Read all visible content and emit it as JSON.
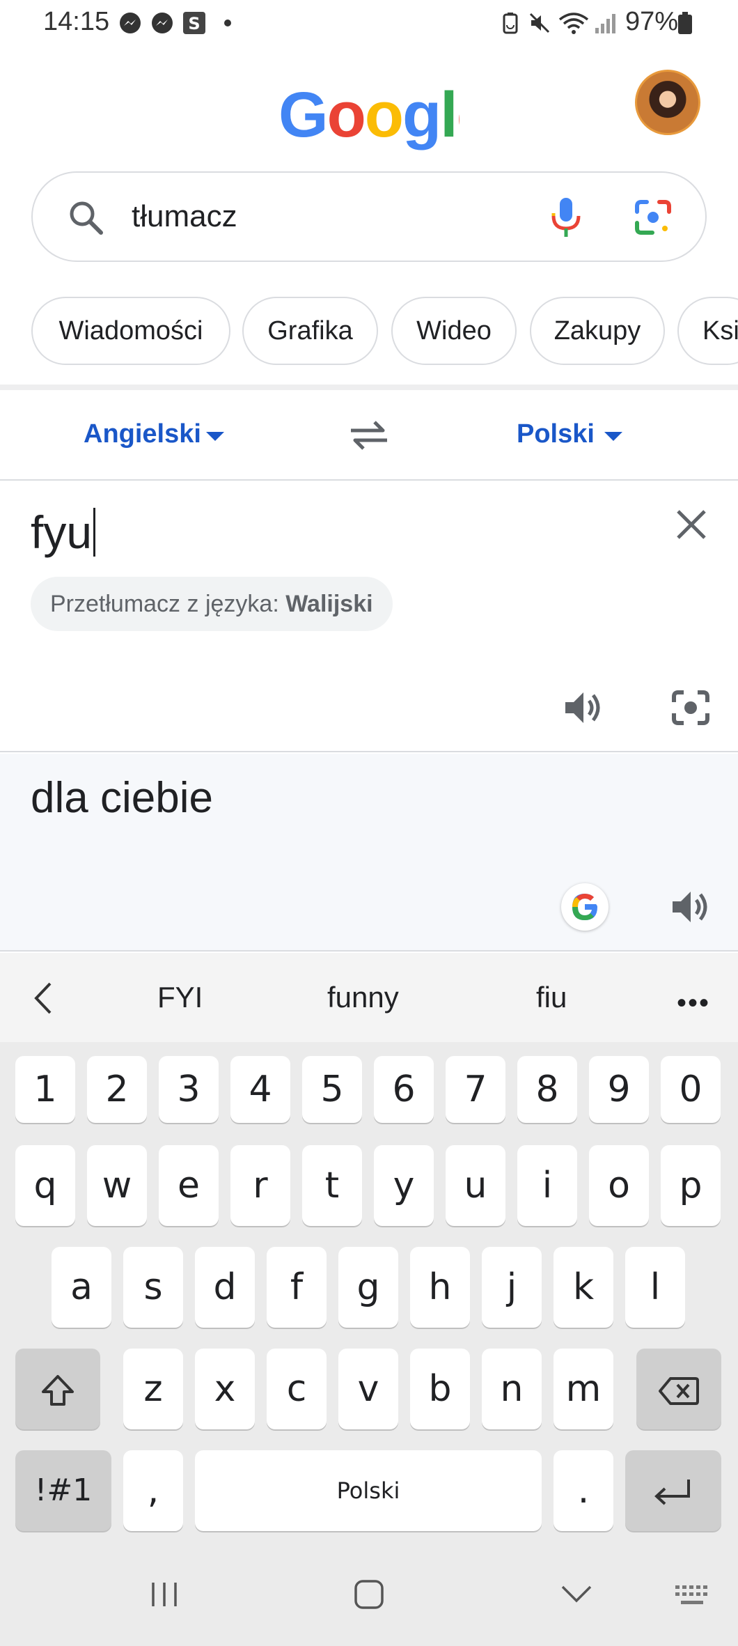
{
  "status_bar": {
    "time": "14:15",
    "battery": "97%",
    "icons": [
      "messenger-icon",
      "messenger-icon",
      "s-app-icon",
      "notification-dot",
      "battery-saver-icon",
      "mute-icon",
      "wifi-icon",
      "signal-icon",
      "battery-icon"
    ]
  },
  "header": {
    "logo_text": "Google",
    "logo_colors": [
      "#4285F4",
      "#EA4335",
      "#FBBC05",
      "#4285F4",
      "#34A853",
      "#EA4335"
    ]
  },
  "search": {
    "query": "tłumacz"
  },
  "chips": [
    {
      "label": "Wiadomości"
    },
    {
      "label": "Grafika"
    },
    {
      "label": "Wideo"
    },
    {
      "label": "Zakupy"
    },
    {
      "label": "Ksi"
    }
  ],
  "translator": {
    "source_lang": "Angielski",
    "target_lang": "Polski",
    "input_text": "fyu",
    "detect_prefix": "Przetłumacz z języka:",
    "detect_lang": "Walijski",
    "output_text": "dla ciebie"
  },
  "keyboard": {
    "suggestions": [
      "FYI",
      "funny",
      "fiu"
    ],
    "more": "•••",
    "row_numbers": [
      "1",
      "2",
      "3",
      "4",
      "5",
      "6",
      "7",
      "8",
      "9",
      "0"
    ],
    "row1": [
      "q",
      "w",
      "e",
      "r",
      "t",
      "y",
      "u",
      "i",
      "o",
      "p"
    ],
    "row2": [
      "a",
      "s",
      "d",
      "f",
      "g",
      "h",
      "j",
      "k",
      "l"
    ],
    "row3": [
      "z",
      "x",
      "c",
      "v",
      "b",
      "n",
      "m"
    ],
    "symbols_label": "!#1",
    "comma": ",",
    "space_label": "Polski",
    "period": "."
  },
  "colors": {
    "accent_blue": "#1a57c8",
    "divider": "#dadce0",
    "keyboard_bg": "#ebebeb"
  }
}
